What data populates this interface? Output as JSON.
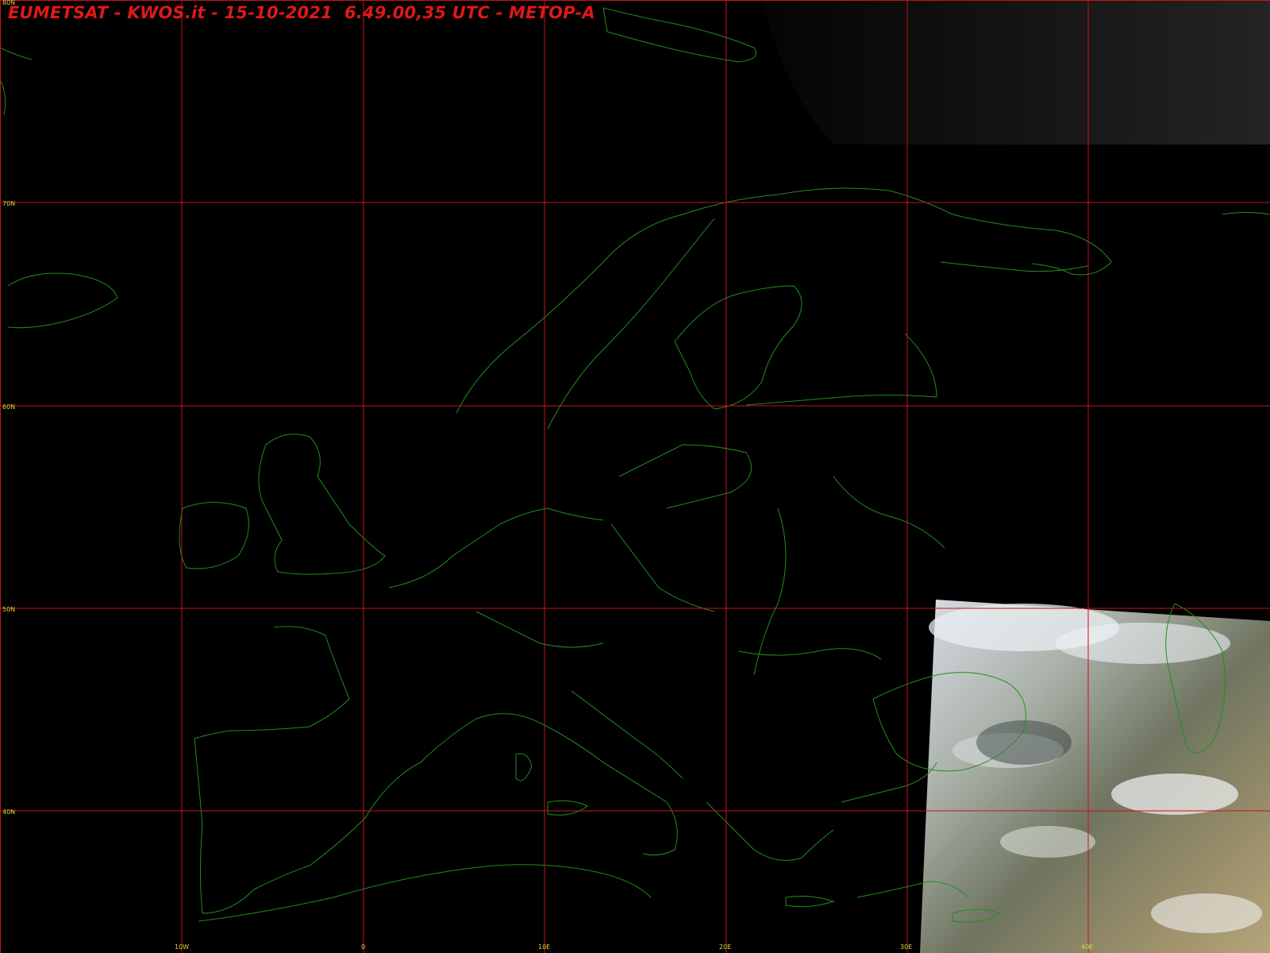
{
  "header": {
    "title": "EUMETSAT - KWOS.it - 15-10-2021  6.49.00,35 UTC - METOP-A"
  },
  "latitude_labels": [
    "80N",
    "70N",
    "60N",
    "50N",
    "40N"
  ],
  "longitude_labels": [
    "10W",
    "0",
    "10E",
    "20E",
    "30E",
    "40E"
  ],
  "colors": {
    "title": "#e01818",
    "grid": "#c81414",
    "coastline": "#1f8f1f",
    "labels": "#d8d840",
    "background": "#000000"
  }
}
